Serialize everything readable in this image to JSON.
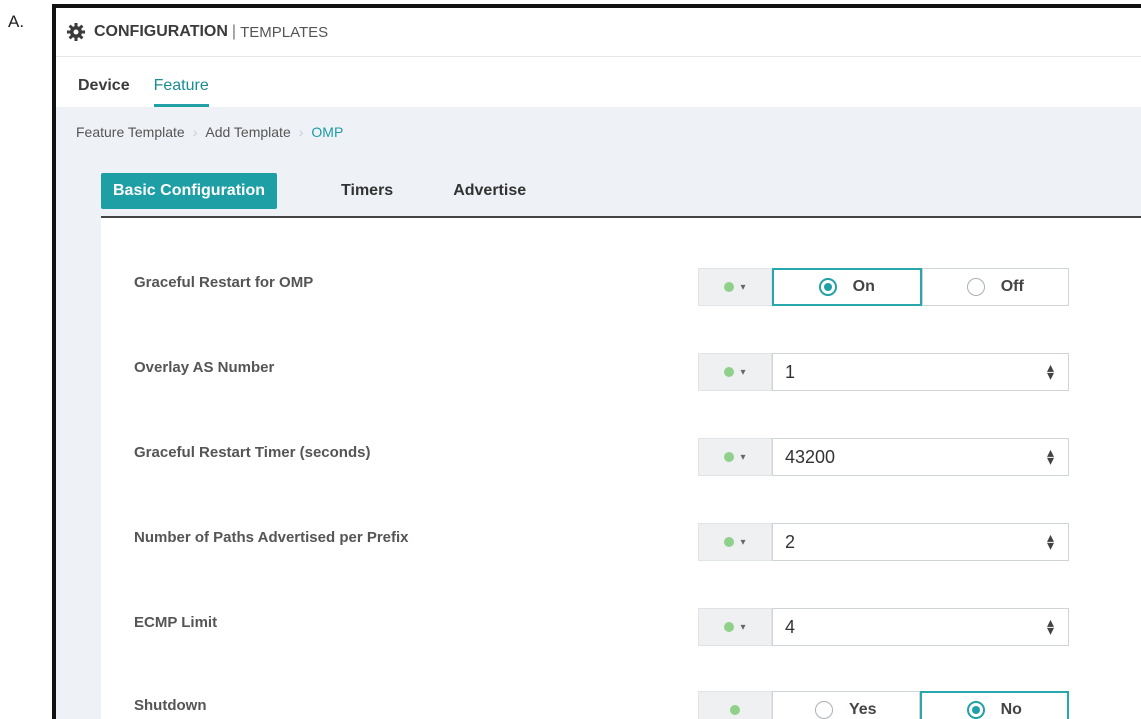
{
  "option_letter": "A.",
  "header": {
    "icon": "gear-icon",
    "title": "CONFIGURATION",
    "separator": "|",
    "subtitle": "TEMPLATES"
  },
  "nav_tabs": [
    {
      "label": "Device",
      "active": false
    },
    {
      "label": "Feature",
      "active": true
    }
  ],
  "breadcrumb": {
    "items": [
      "Feature Template",
      "Add Template",
      "OMP"
    ],
    "separator": "›"
  },
  "section_tabs": [
    {
      "label": "Basic Configuration",
      "active": true
    },
    {
      "label": "Timers",
      "active": false
    },
    {
      "label": "Advertise",
      "active": false
    }
  ],
  "fields": [
    {
      "label": "Graceful Restart for OMP",
      "type": "radio",
      "options": [
        "On",
        "Off"
      ],
      "selected": "On"
    },
    {
      "label": "Overlay AS Number",
      "type": "number",
      "value": "1"
    },
    {
      "label": "Graceful Restart Timer (seconds)",
      "type": "number",
      "value": "43200"
    },
    {
      "label": "Number of Paths Advertised per Prefix",
      "type": "number",
      "value": "2"
    },
    {
      "label": "ECMP Limit",
      "type": "number",
      "value": "4"
    },
    {
      "label": "Shutdown",
      "type": "radio",
      "options": [
        "Yes",
        "No"
      ],
      "selected": "No"
    }
  ],
  "colors": {
    "accent": "#1d9fa5",
    "scope_dot": "#8fd08a"
  }
}
